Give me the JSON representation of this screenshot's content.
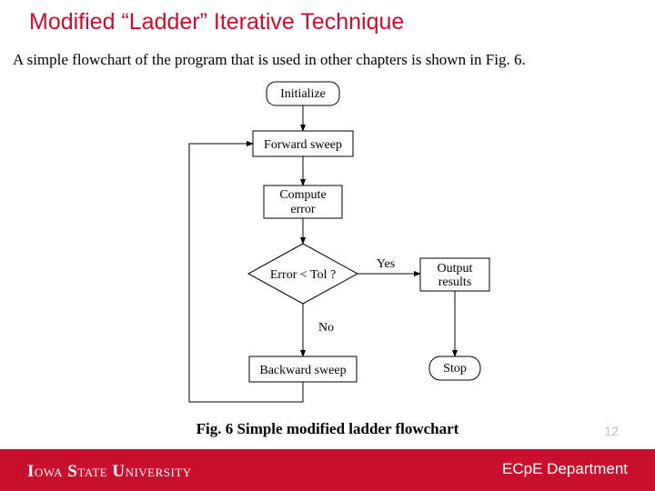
{
  "title": "Modified “Ladder” Iterative Technique",
  "body": "A simple flowchart of the program that is used in other chapters is shown in Fig. 6.",
  "flowchart": {
    "initialize": "Initialize",
    "forward_sweep": "Forward sweep",
    "compute_error": "Compute error",
    "decision": "Error < Tol ?",
    "yes": "Yes",
    "no": "No",
    "output_results_l1": "Output",
    "output_results_l2": "results",
    "backward_sweep": "Backward sweep",
    "stop": "Stop"
  },
  "caption": "Fig. 6 Simple modified ladder flowchart",
  "page_number": "12",
  "footer": {
    "logo": "Iowa State University",
    "department": "ECpE Department"
  }
}
